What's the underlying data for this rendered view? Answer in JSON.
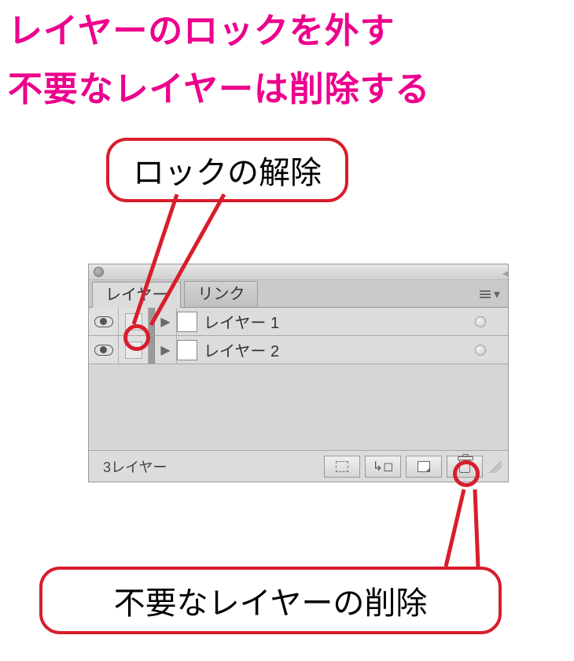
{
  "headline": {
    "line1": "レイヤーのロックを外す",
    "line2": "不要なレイヤーは削除する"
  },
  "callouts": {
    "unlock": "ロックの解除",
    "delete": "不要なレイヤーの削除"
  },
  "panel": {
    "tabs": {
      "layers": "レイヤー",
      "links": "リンク"
    },
    "layers": [
      {
        "name": "レイヤー 1"
      },
      {
        "name": "レイヤー 2"
      }
    ],
    "footer": {
      "count_label": "3レイヤー"
    }
  }
}
